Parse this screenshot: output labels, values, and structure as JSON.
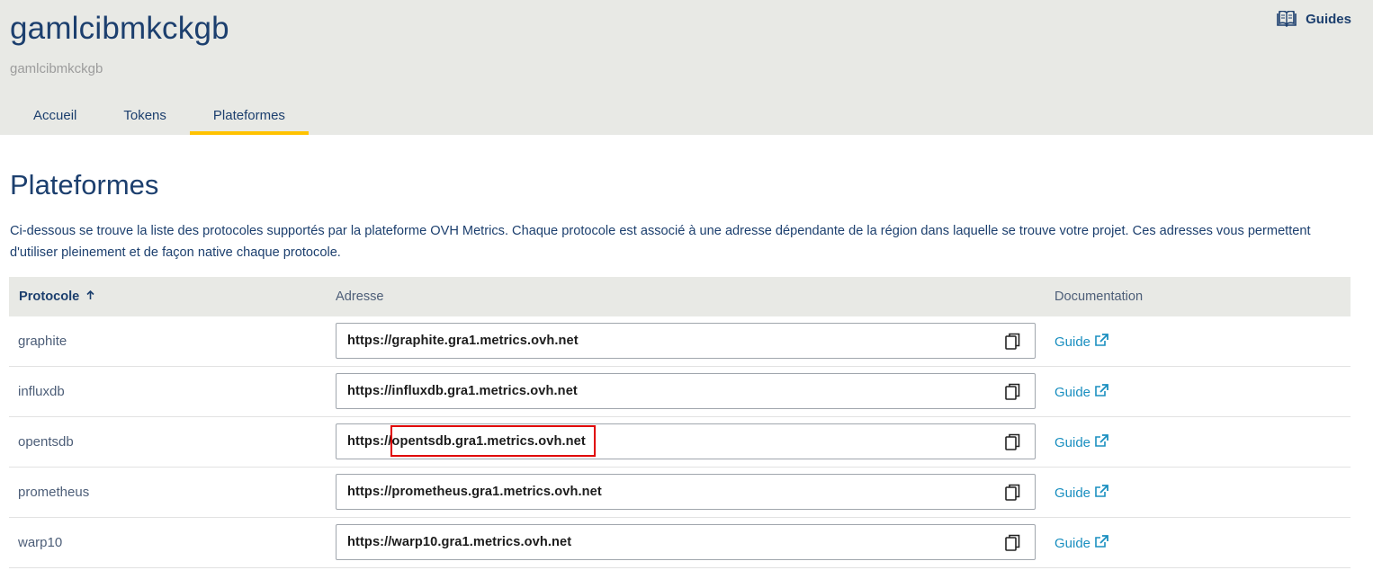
{
  "header": {
    "title": "gamlcibmkckgb",
    "subtitle": "gamlcibmkckgb",
    "guides_label": "Guides"
  },
  "tabs": [
    {
      "label": "Accueil",
      "active": false
    },
    {
      "label": "Tokens",
      "active": false
    },
    {
      "label": "Plateformes",
      "active": true
    }
  ],
  "main": {
    "title": "Plateformes",
    "intro": "Ci-dessous se trouve la liste des protocoles supportés par la plateforme OVH Metrics. Chaque protocole est associé à une adresse dépendante de la région dans laquelle se trouve votre projet. Ces adresses vous permettent d'utiliser pleinement et de façon native chaque protocole."
  },
  "table": {
    "columns": {
      "protocol": "Protocole",
      "address": "Adresse",
      "documentation": "Documentation"
    },
    "rows": [
      {
        "protocol": "graphite",
        "address": "https://graphite.gra1.metrics.ovh.net",
        "doc": "Guide"
      },
      {
        "protocol": "influxdb",
        "address": "https://influxdb.gra1.metrics.ovh.net",
        "doc": "Guide"
      },
      {
        "protocol": "opentsdb",
        "address": "https://opentsdb.gra1.metrics.ovh.net",
        "doc": "Guide"
      },
      {
        "protocol": "prometheus",
        "address": "https://prometheus.gra1.metrics.ovh.net",
        "doc": "Guide"
      },
      {
        "protocol": "warp10",
        "address": "https://warp10.gra1.metrics.ovh.net",
        "doc": "Guide"
      }
    ]
  },
  "colors": {
    "accent": "#ffc200",
    "link": "#1a8fc0",
    "heading": "#1c3f6e",
    "highlight": "#e00000"
  }
}
